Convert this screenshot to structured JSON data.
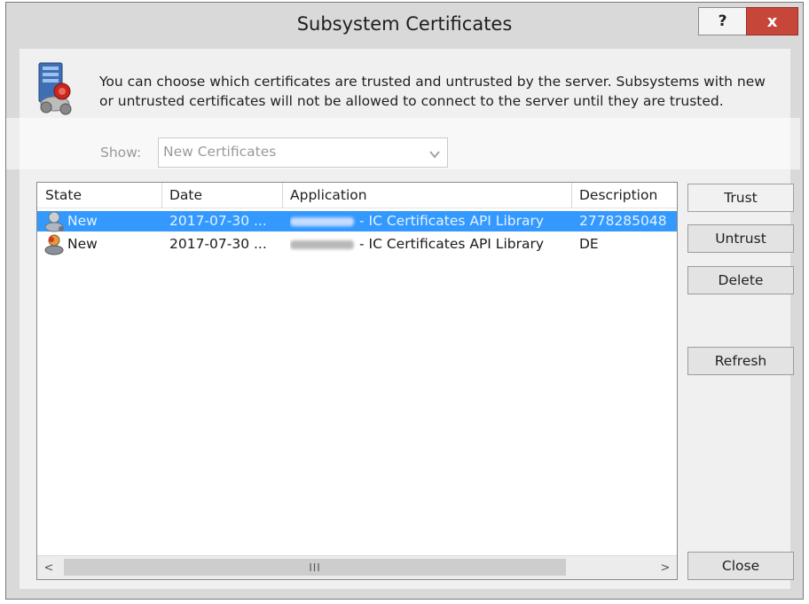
{
  "window": {
    "title": "Subsystem Certificates",
    "help_label": "?",
    "close_label": "x"
  },
  "info": {
    "text": "You can choose which certificates are trusted and untrusted by the server. Subsystems with new or untrusted certificates will not be allowed to connect to the server until they are trusted."
  },
  "show": {
    "label": "Show:",
    "selected": "New Certificates"
  },
  "list": {
    "columns": [
      "State",
      "Date",
      "Application",
      "Description"
    ],
    "rows": [
      {
        "state": "New",
        "date": "2017-07-30 ...",
        "app_suffix": "- IC Certificates API Library",
        "description": "2778285048",
        "selected": true
      },
      {
        "state": "New",
        "date": "2017-07-30 ...",
        "app_suffix": "- IC Certificates API Library",
        "description": "DE",
        "selected": false
      }
    ],
    "scroll_thumb_label": "III",
    "scroll_left": "<",
    "scroll_right": ">"
  },
  "buttons": {
    "trust": "Trust",
    "untrust": "Untrust",
    "delete": "Delete",
    "refresh": "Refresh",
    "close": "Close"
  },
  "colors": {
    "selection": "#3399ff",
    "close_button": "#c7463a"
  }
}
